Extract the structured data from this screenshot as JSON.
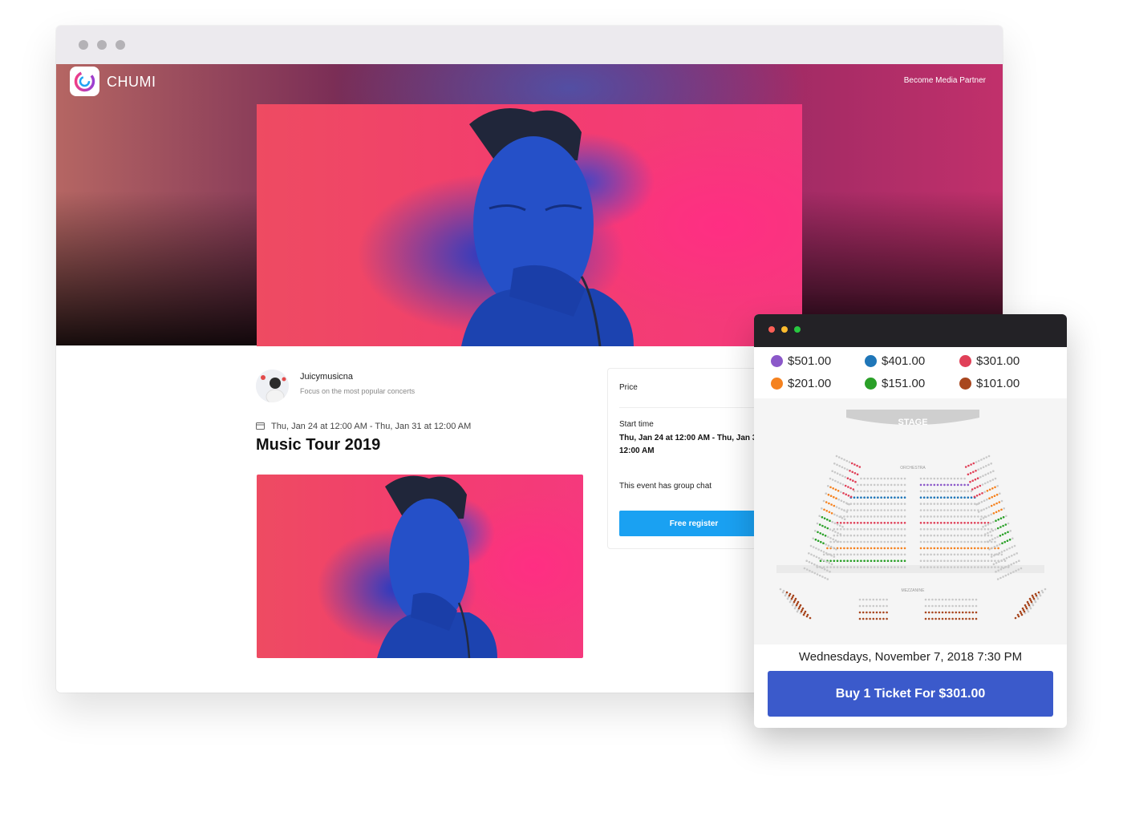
{
  "colors": {
    "accent": "#1aa1f2",
    "buy": "#3b5acb",
    "popup_bar": "#232226"
  },
  "app": {
    "brand": "CHUMI",
    "nav_link": "Become Media Partner"
  },
  "organizer": {
    "name": "Juicymusicna",
    "tagline": "Focus on the most popular concerts"
  },
  "event": {
    "date_range": "Thu, Jan 24 at 12:00 AM - Thu, Jan 31 at 12:00 AM",
    "title": "Music Tour 2019"
  },
  "price_card": {
    "price_label": "Price",
    "start_label": "Start time",
    "start_value": "Thu, Jan 24 at 12:00 AM - Thu, Jan 31 at 12:00 AM",
    "group_chat": "This event has group chat",
    "register_label": "Free register"
  },
  "tickets": {
    "legend": [
      {
        "price": "$501.00",
        "color": "#8b58c9"
      },
      {
        "price": "$401.00",
        "color": "#1f76b8"
      },
      {
        "price": "$301.00",
        "color": "#e04058"
      },
      {
        "price": "$201.00",
        "color": "#f5821f"
      },
      {
        "price": "$151.00",
        "color": "#2aa028"
      },
      {
        "price": "$101.00",
        "color": "#a8471f"
      }
    ],
    "stage_label": "STAGE",
    "orchestra_label": "ORCHESTRA",
    "mezzanine_label": "MEZZANINE",
    "show_date": "Wednesdays, November 7, 2018 7:30 PM",
    "buy_label": "Buy 1 Ticket For $301.00"
  }
}
